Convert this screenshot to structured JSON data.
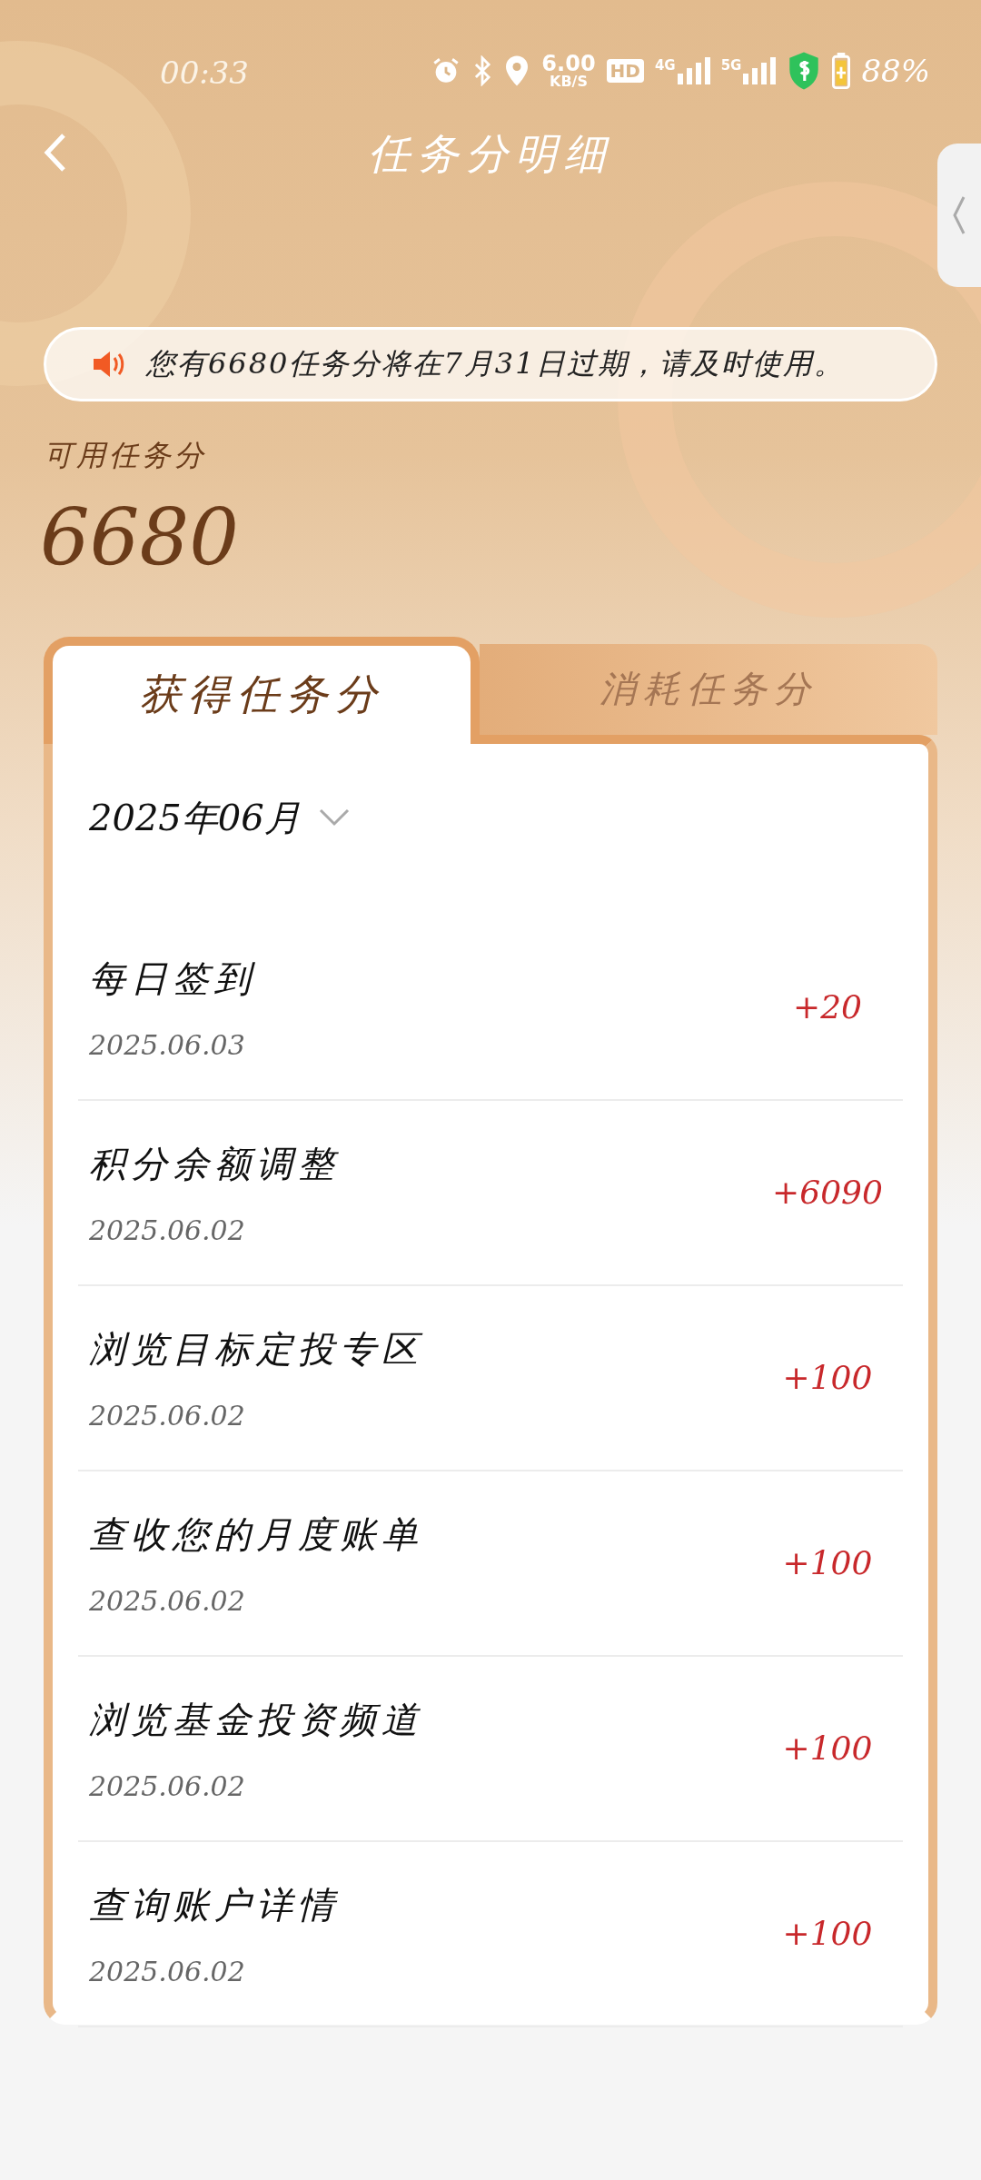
{
  "status_bar": {
    "time": "00:33",
    "speed": "6.00",
    "speed_unit": "KB/S",
    "hd": "HD",
    "network_1": "4G",
    "network_2": "5G",
    "battery": "88%"
  },
  "header": {
    "title": "任务分明细"
  },
  "notice": {
    "text": "您有6680任务分将在7月31日过期，请及时使用。"
  },
  "balance": {
    "label": "可用任务分",
    "value": "6680"
  },
  "tabs": [
    {
      "label": "获得任务分",
      "selected": true
    },
    {
      "label": "消耗任务分",
      "selected": false
    }
  ],
  "month_picker": {
    "value": "2025年06月"
  },
  "records": [
    {
      "title": "每日签到",
      "date": "2025.06.03",
      "points": "+20"
    },
    {
      "title": "积分余额调整",
      "date": "2025.06.02",
      "points": "+6090"
    },
    {
      "title": "浏览目标定投专区",
      "date": "2025.06.02",
      "points": "+100"
    },
    {
      "title": "查收您的月度账单",
      "date": "2025.06.02",
      "points": "+100"
    },
    {
      "title": "浏览基金投资频道",
      "date": "2025.06.02",
      "points": "+100"
    },
    {
      "title": "查询账户详情",
      "date": "2025.06.02",
      "points": "+100"
    }
  ]
}
